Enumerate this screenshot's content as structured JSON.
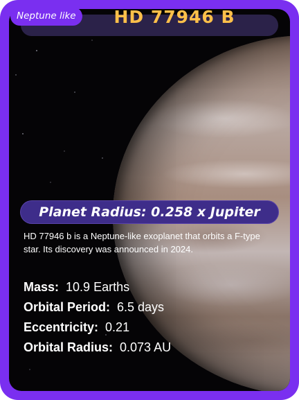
{
  "card": {
    "tag": "Neptune like",
    "name": "HD 77946 B",
    "radius_text": "Planet Radius: 0.258 x Jupiter",
    "description": "HD 77946 b is a Neptune-like exoplanet that orbits a F-type star. Its discovery was announced in 2024.",
    "stats": [
      {
        "label": "Mass:",
        "value": "10.9 Earths"
      },
      {
        "label": "Orbital Period:",
        "value": "6.5 days"
      },
      {
        "label": "Eccentricity:",
        "value": "0.21"
      },
      {
        "label": "Orbital Radius:",
        "value": "0.073 AU"
      }
    ]
  },
  "colors": {
    "frame": "#7a2ff0",
    "title": "#ffc04a",
    "radius_bar": "#3e2d8a",
    "background": "#050406"
  }
}
